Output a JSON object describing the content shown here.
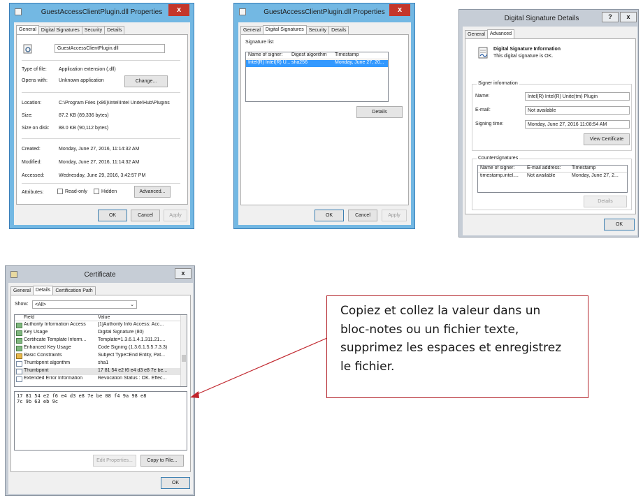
{
  "properties_general": {
    "title": "GuestAccessClientPlugin.dll Properties",
    "close_glyph": "x",
    "tabs": [
      "General",
      "Digital Signatures",
      "Security",
      "Details"
    ],
    "file_name": "GuestAccessClientPlugin.dll",
    "rows": [
      {
        "label": "Type of file:",
        "value": "Application extension (.dll)"
      },
      {
        "label": "Opens with:",
        "value": "Unknown application"
      },
      {
        "label": "Location:",
        "value": "C:\\Program Files (x86)\\Intel\\Intel Unite\\Hub\\Plugins"
      },
      {
        "label": "Size:",
        "value": "87.2 KB (89,336 bytes)"
      },
      {
        "label": "Size on disk:",
        "value": "88.0 KB (90,112 bytes)"
      },
      {
        "label": "Created:",
        "value": "Monday, June 27, 2016, 11:14:32 AM"
      },
      {
        "label": "Modified:",
        "value": "Monday, June 27, 2016, 11:14:32 AM"
      },
      {
        "label": "Accessed:",
        "value": "Wednesday, June 29, 2016, 3:42:57 PM"
      }
    ],
    "change_label": "Change...",
    "attributes_label": "Attributes:",
    "readonly_label": "Read-only",
    "hidden_label": "Hidden",
    "advanced_label": "Advanced...",
    "ok_label": "OK",
    "cancel_label": "Cancel",
    "apply_label": "Apply"
  },
  "properties_signatures": {
    "title": "GuestAccessClientPlugin.dll Properties",
    "close_glyph": "x",
    "tabs": [
      "General",
      "Digital Signatures",
      "Security",
      "Details"
    ],
    "group_label": "Signature list",
    "columns": [
      "Name of signer:",
      "Digest algorithm",
      "Timestamp"
    ],
    "row": [
      "Intel(R) Intel(R) U...",
      "sha256",
      "Monday, June 27, 20..."
    ],
    "details_label": "Details",
    "ok_label": "OK",
    "cancel_label": "Cancel",
    "apply_label": "Apply"
  },
  "signature_details": {
    "title": "Digital Signature Details",
    "help_glyph": "?",
    "close_glyph": "x",
    "tabs": [
      "General",
      "Advanced"
    ],
    "info_heading": "Digital Signature Information",
    "info_text": "This digital signature is OK.",
    "signer_group": "Signer information",
    "name_label": "Name:",
    "name_value": "Intel(R) Intel(R) Unite(tm) Plugin",
    "email_label": "E-mail:",
    "email_value": "Not available",
    "signing_time_label": "Signing time:",
    "signing_time_value": "Monday, June 27, 2016 11:08:54 AM",
    "view_certificate_label": "View Certificate",
    "counter_group": "Countersignatures",
    "counter_columns": [
      "Name of signer:",
      "E-mail address:",
      "Timestamp"
    ],
    "counter_row": [
      "timestamp.intel....",
      "Not available",
      "Monday, June 27, 2..."
    ],
    "details_label": "Details",
    "ok_label": "OK"
  },
  "certificate": {
    "title": "Certificate",
    "close_glyph": "x",
    "tabs": [
      "General",
      "Details",
      "Certification Path"
    ],
    "show_label": "Show:",
    "show_value": "<All>",
    "columns": [
      "Field",
      "Value"
    ],
    "fields": [
      {
        "field": "Authority Information Access",
        "value": "[1]Authority Info Access: Acc...",
        "icon": "cert-ext"
      },
      {
        "field": "Key Usage",
        "value": "Digital Signature (80)",
        "icon": "cert-ext"
      },
      {
        "field": "Certificate Template Inform...",
        "value": "Template=1.3.6.1.4.1.311.21....",
        "icon": "cert-ext"
      },
      {
        "field": "Enhanced Key Usage",
        "value": "Code Signing (1.3.6.1.5.5.7.3.3)",
        "icon": "cert-ext"
      },
      {
        "field": "Basic Constraints",
        "value": "Subject Type=End Entity, Pat...",
        "icon": "cert-warn"
      },
      {
        "field": "Thumbprint algorithm",
        "value": "sha1",
        "icon": "doc"
      },
      {
        "field": "Thumbprint",
        "value": "17 81 54 e2 f6 e4 d3 e8 7e be...",
        "icon": "doc"
      },
      {
        "field": "Extended Error Information",
        "value": "Revocation Status : OK. Effec...",
        "icon": "doc"
      }
    ],
    "selected_index": 6,
    "thumbprint_line1": "17 81 54 e2 f6 e4 d3 e8 7e be 08 f4 9a 98 e8",
    "thumbprint_line2": "7c 9b 63 eb 9c",
    "edit_properties_label": "Edit Properties...",
    "copy_to_file_label": "Copy to File...",
    "ok_label": "OK"
  },
  "callout": {
    "text": "Copiez et collez la valeur dans un bloc-notes ou un fichier texte, supprimez les espaces et enregistrez le fichier.",
    "border_color": "#b3242b"
  },
  "colors": {
    "window_frame": "#73b8e3",
    "close_button": "#c4362a",
    "selection": "#3399ff",
    "arrow": "#c0242b"
  }
}
